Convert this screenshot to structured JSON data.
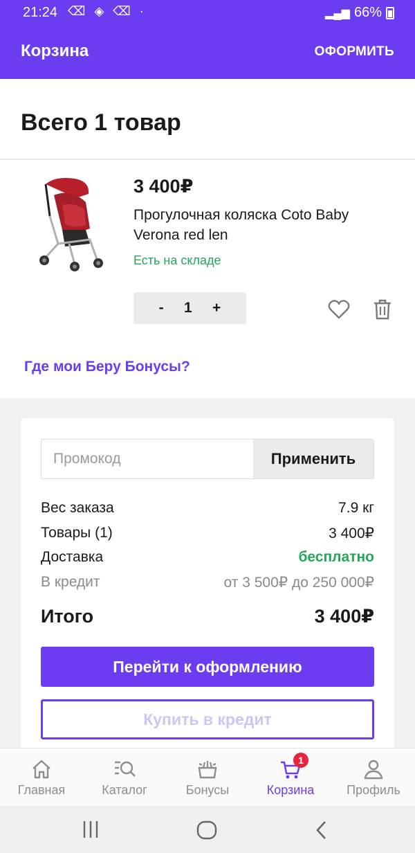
{
  "status_bar": {
    "time": "21:24",
    "battery": "66%"
  },
  "app_bar": {
    "title": "Корзина",
    "action": "ОФОРМИТЬ"
  },
  "cart": {
    "heading": "Всего 1 товар",
    "item": {
      "price": "3 400₽",
      "name": "Прогулочная коляска Coto Baby Verona red len",
      "stock": "Есть на складе",
      "qty_minus": "-",
      "qty": "1",
      "qty_plus": "+"
    },
    "bonus_link": "Где мои Беру Бонусы?"
  },
  "summary": {
    "promo_placeholder": "Промокод",
    "apply_label": "Применить",
    "rows": [
      {
        "label": "Вес заказа",
        "value": "7.9 кг"
      },
      {
        "label": "Товары (1)",
        "value": "3 400₽"
      },
      {
        "label": "Доставка",
        "value": "бесплатно"
      },
      {
        "label": "В кредит",
        "value": "от 3 500₽ до 250 000₽"
      }
    ],
    "total_label": "Итого",
    "total_value": "3 400₽",
    "checkout_label": "Перейти к оформлению",
    "credit_label": "Купить в кредит"
  },
  "bottom_nav": [
    {
      "label": "Главная",
      "icon": "home-icon"
    },
    {
      "label": "Каталог",
      "icon": "catalog-search-icon"
    },
    {
      "label": "Бонусы",
      "icon": "bonus-gift-icon"
    },
    {
      "label": "Корзина",
      "icon": "cart-icon",
      "badge": "1",
      "active": true
    },
    {
      "label": "Профиль",
      "icon": "profile-icon"
    }
  ],
  "colors": {
    "brand": "#6b3cf0",
    "success": "#26a65b",
    "badge": "#e8243c"
  }
}
